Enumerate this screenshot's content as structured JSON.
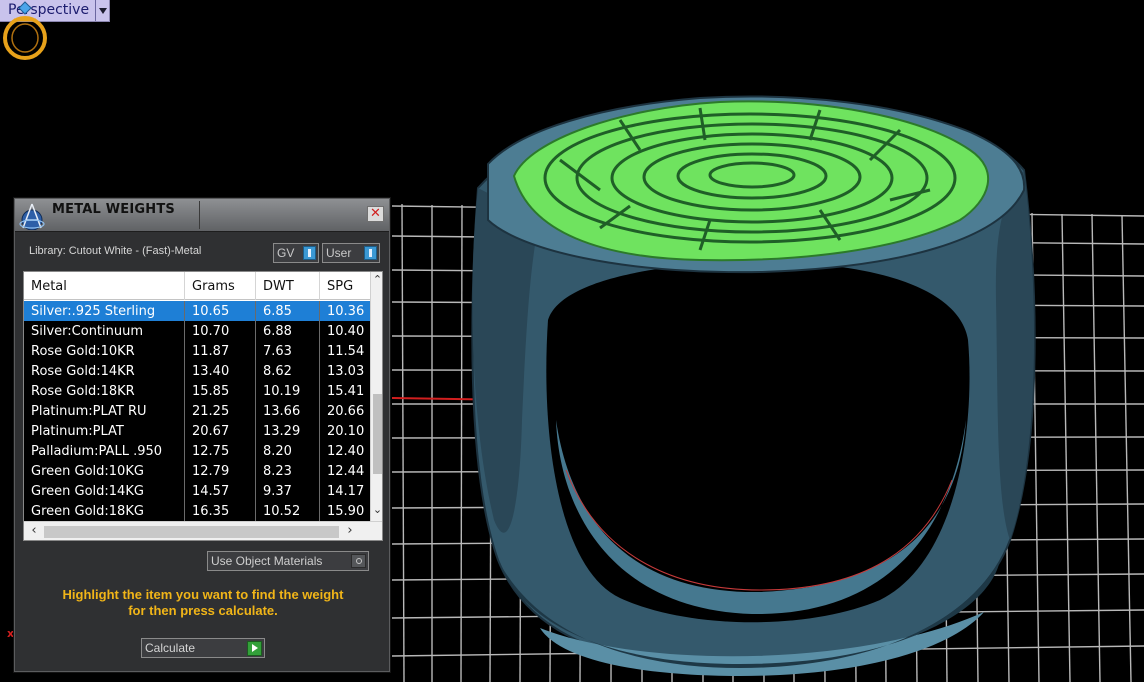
{
  "viewport": {
    "label": "Perspective",
    "axis_x_label": "x",
    "colors": {
      "background": "#000000",
      "grid": "#bdbdbd",
      "ring_body": "#3f6f86",
      "ring_top": "#6fe35f",
      "axis_x": "#d21f1f",
      "axis_y": "#2ad1c9"
    }
  },
  "panel": {
    "title": "METAL WEIGHTS",
    "close_symbol": "✕",
    "library_label": "Library: Cutout White - (Fast)-Metal",
    "gv_label": "GV",
    "user_label": "User",
    "columns": [
      "Metal",
      "Grams",
      "DWT",
      "SPG"
    ],
    "rows": [
      {
        "metal": "Silver:.925 Sterling",
        "grams": "10.65",
        "dwt": "6.85",
        "spg": "10.36",
        "selected": true
      },
      {
        "metal": "Silver:Continuum",
        "grams": "10.70",
        "dwt": "6.88",
        "spg": "10.40",
        "selected": false
      },
      {
        "metal": "Rose Gold:10KR",
        "grams": "11.87",
        "dwt": "7.63",
        "spg": "11.54",
        "selected": false
      },
      {
        "metal": "Rose Gold:14KR",
        "grams": "13.40",
        "dwt": "8.62",
        "spg": "13.03",
        "selected": false
      },
      {
        "metal": "Rose Gold:18KR",
        "grams": "15.85",
        "dwt": "10.19",
        "spg": "15.41",
        "selected": false
      },
      {
        "metal": "Platinum:PLAT RU",
        "grams": "21.25",
        "dwt": "13.66",
        "spg": "20.66",
        "selected": false
      },
      {
        "metal": "Platinum:PLAT",
        "grams": "20.67",
        "dwt": "13.29",
        "spg": "20.10",
        "selected": false
      },
      {
        "metal": "Palladium:PALL .950",
        "grams": "12.75",
        "dwt": "8.20",
        "spg": "12.40",
        "selected": false
      },
      {
        "metal": "Green Gold:10KG",
        "grams": "12.79",
        "dwt": "8.23",
        "spg": "12.44",
        "selected": false
      },
      {
        "metal": "Green Gold:14KG",
        "grams": "14.57",
        "dwt": "9.37",
        "spg": "14.17",
        "selected": false
      },
      {
        "metal": "Green Gold:18KG",
        "grams": "16.35",
        "dwt": "10.52",
        "spg": "15.90",
        "selected": false
      }
    ],
    "use_object_materials": "Use Object Materials",
    "help_text_line1": "Highlight the item you want to find the weight",
    "help_text_line2": "for then press calculate.",
    "calculate_label": "Calculate",
    "colors": {
      "selected_row": "#1e7fd6",
      "help_text": "#f1b518",
      "toggle_button": "#3b99d4",
      "calculate_button": "#33a03a"
    }
  }
}
